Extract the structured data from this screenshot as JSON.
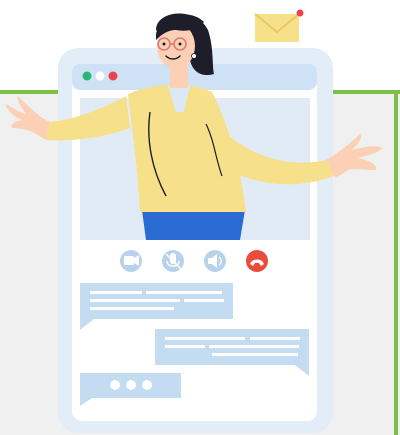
{
  "colors": {
    "background_panel": "#f0f0f0",
    "accent_green": "#7cc046",
    "phone_frame": "#e3edf8",
    "screen_bg": "#ffffff",
    "titlebar": "#cfe1f4",
    "video_area": "#e1ebf5",
    "chat_bubble": "#c4dcf2",
    "chat_line": "#ffffff",
    "control_button": "#b9d2ec",
    "end_call_red": "#e74c3c",
    "dot_green": "#2bb673",
    "dot_white": "#ffffff",
    "dot_red": "#ef4050",
    "envelope": "#f7e08a",
    "notification_red": "#ef4050",
    "skin": "#fbd0b5",
    "hair": "#1e1e2a",
    "sweater": "#f7e08a",
    "shirt": "#dbe9f6",
    "pants": "#2a6ad3"
  },
  "icons": {
    "window_dots": [
      "dot-green-icon",
      "dot-white-icon",
      "dot-red-icon"
    ],
    "call_controls": [
      "video-camera-icon",
      "microphone-muted-icon",
      "speaker-icon",
      "end-call-icon"
    ],
    "mail": "envelope-icon",
    "typing": "typing-dots-icon"
  }
}
